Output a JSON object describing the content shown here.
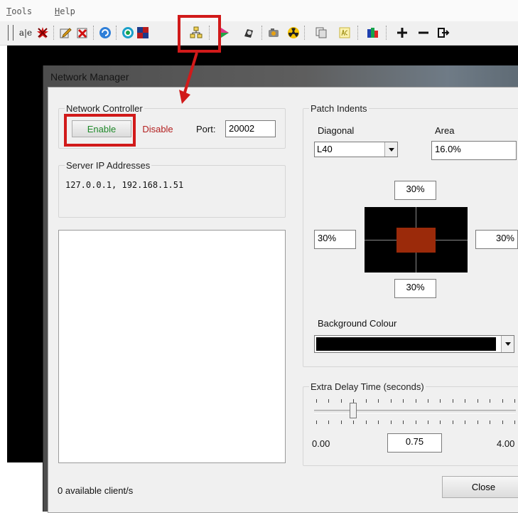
{
  "menu": {
    "tools_prefix": "T",
    "tools_rest": "ools",
    "help_prefix": "H",
    "help_rest": "elp"
  },
  "toolbar": {
    "text_icon_label": "a|e",
    "icons": [
      "text-icon",
      "red-star-icon",
      "edit-icon",
      "delete-icon",
      "refresh-icon",
      "target-icon",
      "grid-icon",
      "network-icon",
      "play-icon",
      "capture-icon",
      "camera-icon",
      "radiation-icon",
      "copy-icon",
      "asc-icon",
      "colour-bars-icon",
      "plus-icon",
      "minus-icon",
      "exit-icon"
    ]
  },
  "dialog": {
    "title": "Network Manager",
    "network_controller": {
      "title": "Network Controller",
      "enable_label": "Enable",
      "disable_label": "Disable",
      "port_label": "Port:",
      "port_value": "20002"
    },
    "server_ip": {
      "title": "Server IP Addresses",
      "value": "127.0.0.1, 192.168.1.51"
    },
    "status": "0 available client/s",
    "close_label": "Close",
    "patch_indents": {
      "title": "Patch Indents",
      "diagonal_label": "Diagonal",
      "diagonal_value": "L40",
      "area_label": "Area",
      "area_value": "16.0%",
      "top_value": "30%",
      "left_value": "30%",
      "right_value": "30%",
      "bottom_value": "30%",
      "patch_color": "#9b2a0a",
      "background_label": "Background Colour",
      "background_value": "#000000"
    },
    "extra_delay": {
      "title": "Extra Delay Time (seconds)",
      "min_label": "0.00",
      "max_label": "4.00",
      "value": "0.75",
      "min": 0,
      "max": 4,
      "current": 0.75
    }
  }
}
